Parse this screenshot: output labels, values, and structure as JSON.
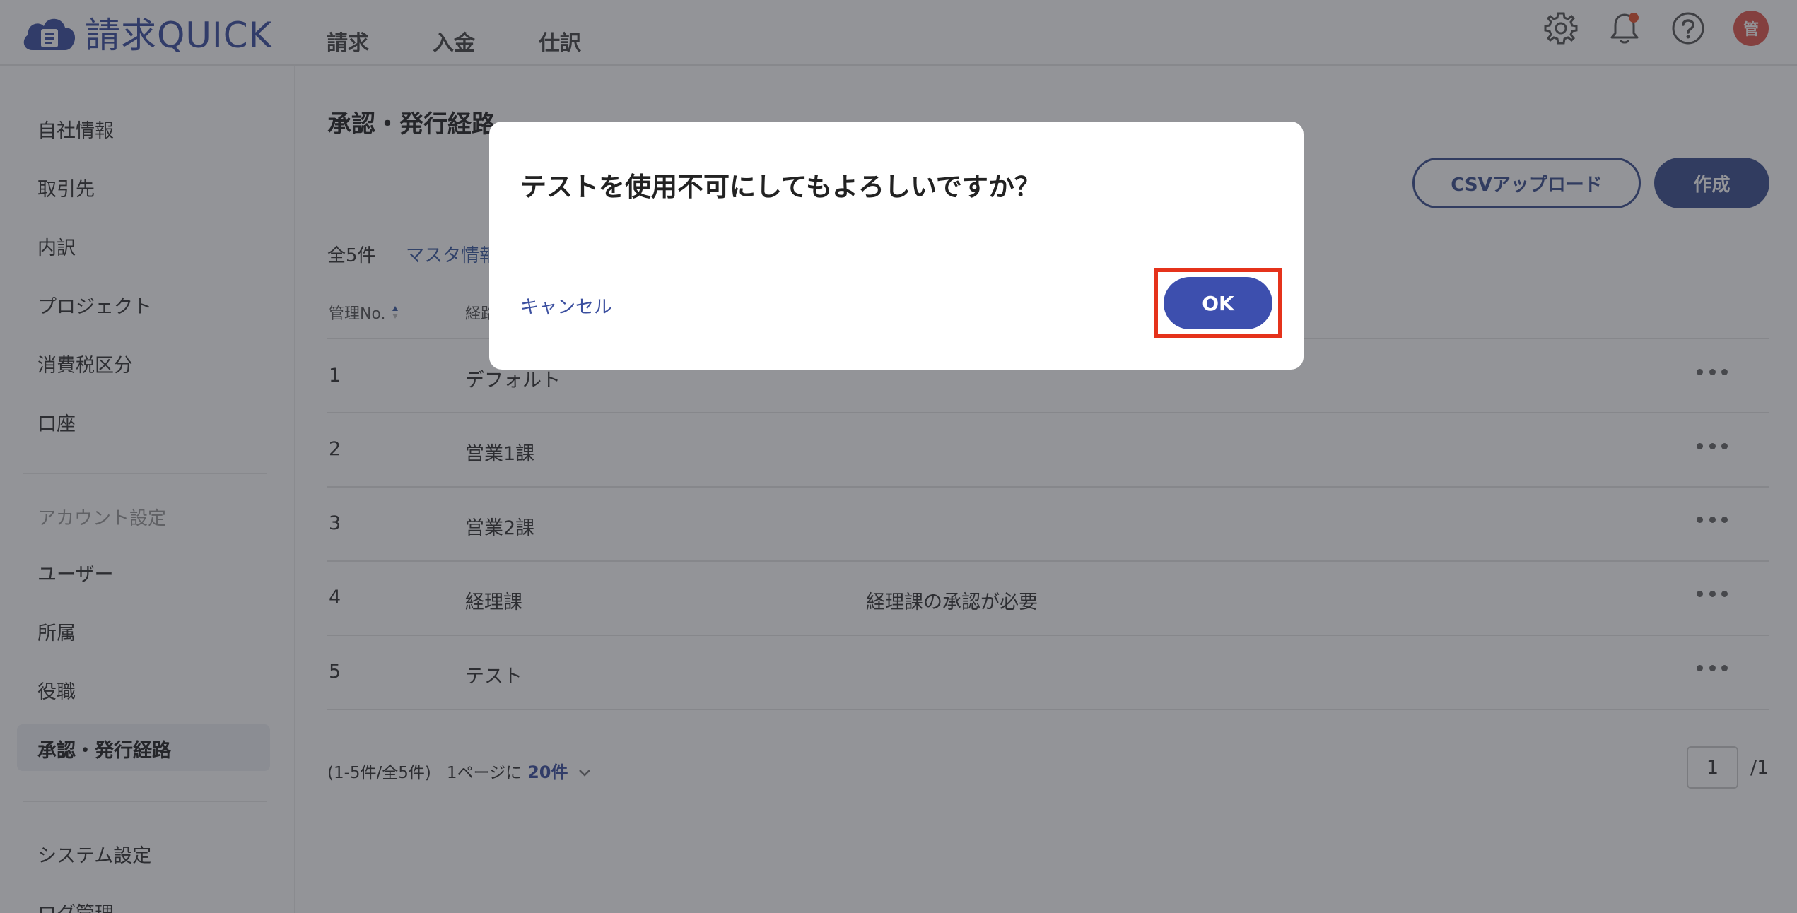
{
  "header": {
    "logo_text": "請求QUICK",
    "nav": [
      "請求",
      "入金",
      "仕訳"
    ],
    "avatar_initial": "管"
  },
  "sidebar": {
    "items": [
      "自社情報",
      "取引先",
      "内訳",
      "プロジェクト",
      "消費税区分",
      "口座"
    ],
    "account_section": "アカウント設定",
    "account_items": [
      "ユーザー",
      "所属",
      "役職",
      "承認・発行経路"
    ],
    "system_items": [
      "システム設定",
      "ログ管理"
    ],
    "active_item": "承認・発行経路"
  },
  "main": {
    "title": "承認・発行経路",
    "csv_button": "CSVアップロード",
    "create_button": "作成",
    "count": "全5件",
    "master_link": "マスタ情報",
    "columns": [
      "管理No.",
      "経路"
    ],
    "rows": [
      {
        "no": "1",
        "name": "デフォルト",
        "note": ""
      },
      {
        "no": "2",
        "name": "営業1課",
        "note": ""
      },
      {
        "no": "3",
        "name": "営業2課",
        "note": ""
      },
      {
        "no": "4",
        "name": "経理課",
        "note": "経理課の承認が必要"
      },
      {
        "no": "5",
        "name": "テスト",
        "note": ""
      }
    ],
    "pager": {
      "range": "(1-5件/全5件)",
      "per_page_label": "1ページに",
      "per_page_value": "20件",
      "current_page": "1",
      "total_pages": "/1"
    }
  },
  "dialog": {
    "message": "テストを使用不可にしてもよろしいですか？",
    "cancel_label": "キャンセル",
    "ok_label": "OK"
  },
  "colors": {
    "brand": "#3b4fa0",
    "primary_button": "#3b4f8f",
    "highlight": "#e5321b",
    "notification": "#e5532f"
  }
}
